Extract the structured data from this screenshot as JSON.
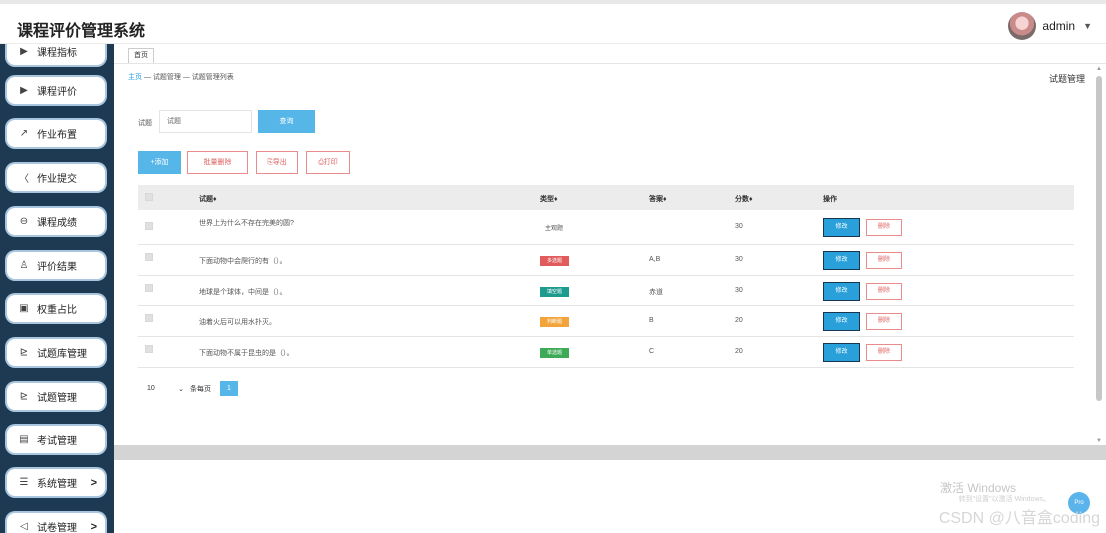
{
  "app": {
    "title": "课程评价管理系统"
  },
  "user": {
    "name": "admin"
  },
  "sidebar": {
    "items": [
      {
        "label": "课程指标",
        "icon": "play-icon",
        "glyph": "▶"
      },
      {
        "label": "课程评价",
        "icon": "play-icon",
        "glyph": "▶"
      },
      {
        "label": "作业布置",
        "icon": "chart-line-icon",
        "glyph": "↗"
      },
      {
        "label": "作业提交",
        "icon": "chevron-left-icon",
        "glyph": "〈"
      },
      {
        "label": "课程成绩",
        "icon": "minus-circle-icon",
        "glyph": "⊖"
      },
      {
        "label": "评价结果",
        "icon": "user-icon",
        "glyph": "♙"
      },
      {
        "label": "权重占比",
        "icon": "calendar-icon",
        "glyph": "▣"
      },
      {
        "label": "试题库管理",
        "icon": "bar-chart-icon",
        "glyph": "⊵"
      },
      {
        "label": "试题管理",
        "icon": "bar-chart-icon",
        "glyph": "⊵"
      },
      {
        "label": "考试管理",
        "icon": "document-icon",
        "glyph": "▤"
      },
      {
        "label": "系统管理",
        "icon": "list-icon",
        "glyph": "☰",
        "arrow": ">"
      },
      {
        "label": "试卷管理",
        "icon": "speaker-icon",
        "glyph": "◁",
        "arrow": ">"
      }
    ]
  },
  "tabs": [
    {
      "label": "首页"
    }
  ],
  "breadcrumb": {
    "home": "主页",
    "sep1": " — ",
    "section": "试题管理",
    "sep2": " — ",
    "page": "试题管理列表"
  },
  "page_heading": "试题管理",
  "search": {
    "label": "试题",
    "placeholder": "试题",
    "button": "查询"
  },
  "actions": {
    "add": "+添加",
    "batch_delete": "批量删除",
    "export": "导出",
    "print": "打印"
  },
  "table": {
    "headers": {
      "question": "试题♦",
      "type": "类型♦",
      "answer": "答案♦",
      "score": "分数♦",
      "ops": "操作"
    },
    "rows": [
      {
        "question": "世界上为什么不存在完美的圆?",
        "type": "主观题",
        "type_style": "plain",
        "answer": "",
        "score": "30",
        "edit": "修改",
        "delete": "删除"
      },
      {
        "question": "下面动物中会爬行的有（）。",
        "type": "多选题",
        "type_style": "red",
        "answer": "A,B",
        "score": "30",
        "edit": "修改",
        "delete": "删除"
      },
      {
        "question": "地球是个球体，中间是（）。",
        "type": "填空题",
        "type_style": "teal",
        "answer": "赤道",
        "score": "30",
        "edit": "修改",
        "delete": "删除"
      },
      {
        "question": "油着火后可以用水扑灭。",
        "type": "判断题",
        "type_style": "orange",
        "answer": "B",
        "score": "20",
        "edit": "修改",
        "delete": "删除"
      },
      {
        "question": "下面动物不属于昆虫的是（）。",
        "type": "单选题",
        "type_style": "green",
        "answer": "C",
        "score": "20",
        "edit": "修改",
        "delete": "删除"
      }
    ]
  },
  "pagination": {
    "page_size": "10",
    "per_page_label": "条每页",
    "current_page": "1"
  },
  "colors": {
    "primary": "#57b6e8",
    "danger": "#e06060",
    "sidebar": "#1d3a52",
    "red": "#e15b5b",
    "teal": "#1e9b8f",
    "orange": "#f2a33a",
    "green": "#3daa56"
  },
  "windows_watermark": {
    "title": "激活 Windows",
    "subtitle": "转到\"设置\"以激活 Windows。"
  },
  "fab_label": "Pro",
  "csdn_watermark": "CSDN @八音盒coding"
}
